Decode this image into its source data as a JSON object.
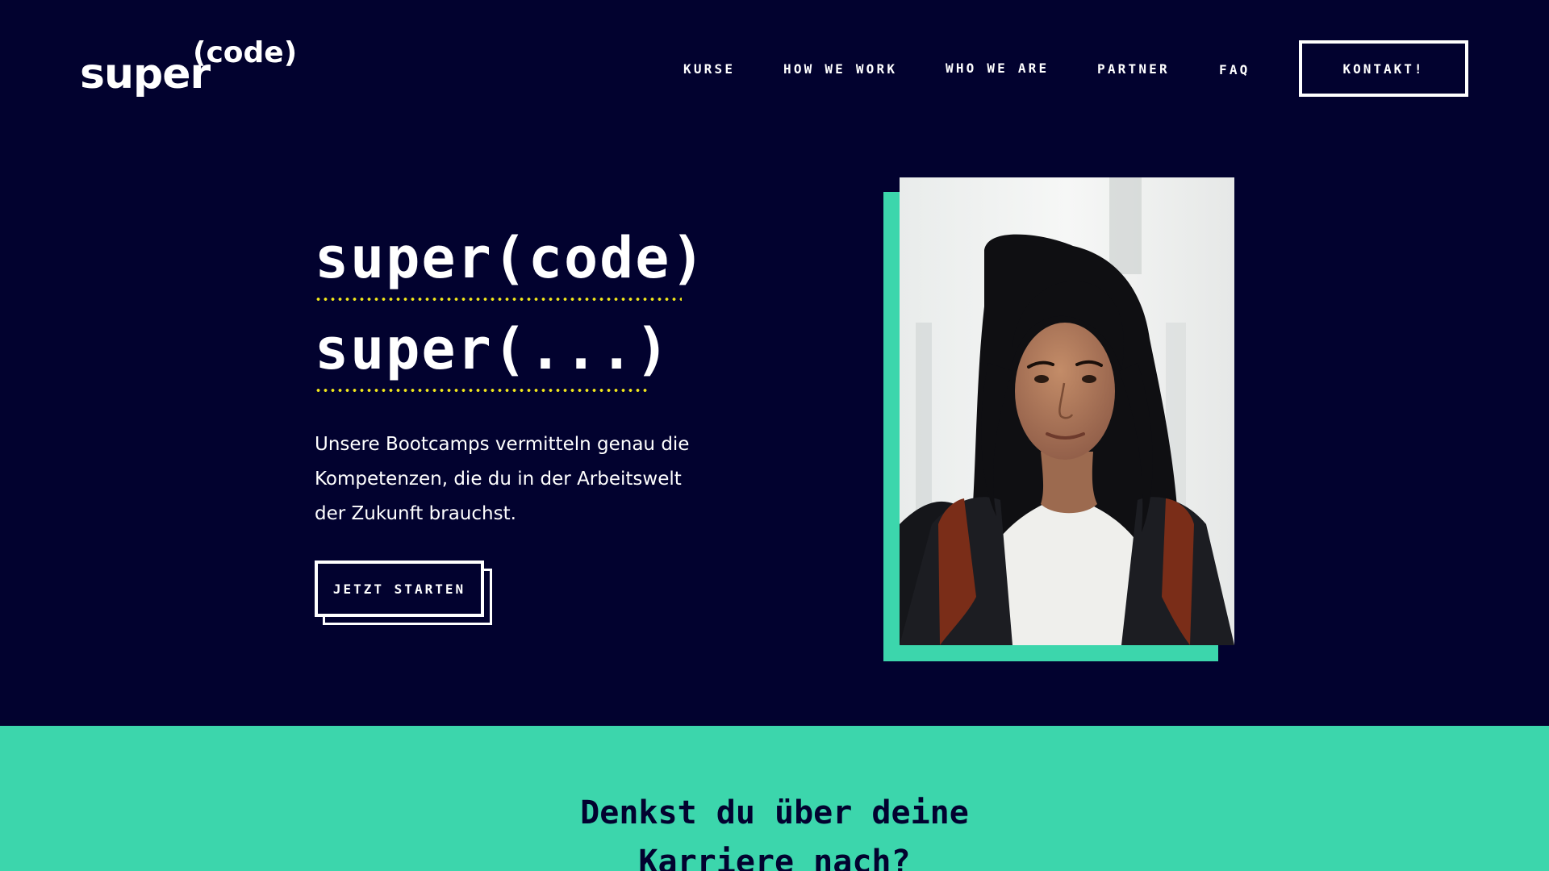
{
  "header": {
    "logo_main": "super",
    "logo_sup": "(code)",
    "nav": [
      "KURSE",
      "HOW WE WORK",
      "WHO WE ARE",
      "PARTNER",
      "FAQ"
    ],
    "contact_label": "KONTAKT!"
  },
  "hero": {
    "title_line_1": "super(code)",
    "title_line_2": "super(...)",
    "description": "Unsere Bootcamps vermitteln genau die Kompetenzen, die du in der Arbeitswelt der Zukunft brauchst.",
    "cta_label": "JETZT STARTEN"
  },
  "career": {
    "heading_line_1": "Denkst du über deine",
    "heading_line_2": "Karriere nach?"
  },
  "colors": {
    "background": "#02022f",
    "accent": "#3cd6ac",
    "underline": "#f0e61a",
    "text": "#ffffff"
  },
  "icons": [
    "portrait-photo"
  ]
}
